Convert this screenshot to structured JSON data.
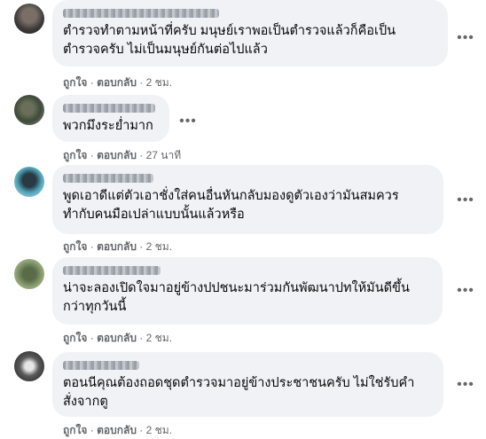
{
  "comments": [
    {
      "text": "ตำรวจทำตามหน้าที่ครับ มนุษย์เราพอเป็นตำรวจแล้วก็คือเป็น\nตำรวจครับ ไม่เป็นมนุษย์กันต่อไปแล้ว",
      "like_label": "ถูกใจ",
      "reply_label": "ตอบกลับ",
      "time": "2 ชม."
    },
    {
      "text": "พวกมึงระย่ำมาก",
      "like_label": "ถูกใจ",
      "reply_label": "ตอบกลับ",
      "time": "27 นาที"
    },
    {
      "text": "พูดเอาดีแต่ตัวเอาชั่งใส่คนอื่นหันกลับมองดูตัวเองว่ามันสมควร\nทำกับคนมือเปล่าแบบนั้นแล้วหรือ",
      "like_label": "ถูกใจ",
      "reply_label": "ตอบกลับ",
      "time": "2 ชม."
    },
    {
      "text": "น่าจะลองเปิดใจมาอยู่ข้างปปชนะมาร่วมกันพัฒนาปทให้มันดีขึ้น\nกว่าทุกวันนี้",
      "like_label": "ถูกใจ",
      "reply_label": "ตอบกลับ",
      "time": "2 ชม."
    },
    {
      "text": "ตอนนีคุณต้องถอดชุดตำรวจมาอยู่ข้างประชาชนครับ ไม่ใช่รับคำ\nสั่งจากตู",
      "like_label": "ถูกใจ",
      "reply_label": "ตอบกลับ",
      "time": "2 ชม."
    }
  ],
  "separator": " · ",
  "more_label": "•••"
}
